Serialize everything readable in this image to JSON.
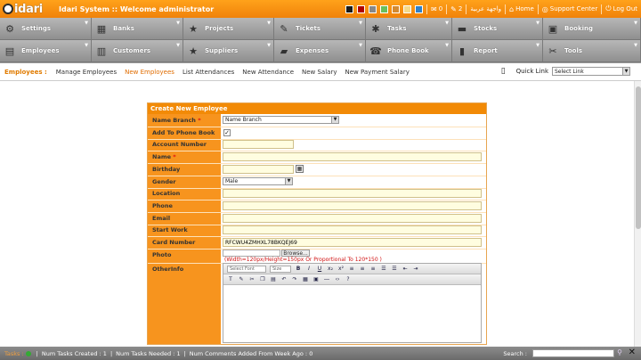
{
  "app": {
    "logo_text": "idari",
    "title": "Idari System :: Welcome administrator"
  },
  "topbar": {
    "swatches": [
      "#1a1a1a",
      "#b00000",
      "#888888",
      "#6bbf5b",
      "#d48a30",
      "#f5d98a",
      "#2f80c8"
    ],
    "mail_count": "0",
    "tasks_count": "2",
    "arabic_label": "واجهة عربية",
    "home_label": "Home",
    "support_label": "Support Center",
    "logout_label": "Log Out"
  },
  "modules": [
    {
      "label": "Settings",
      "icon": "wrench-icon",
      "glyph": "⚙"
    },
    {
      "label": "Banks",
      "icon": "bank-icon",
      "glyph": "▦"
    },
    {
      "label": "Projects",
      "icon": "star-icon",
      "glyph": "★"
    },
    {
      "label": "Tickets",
      "icon": "ticket-icon",
      "glyph": "✎"
    },
    {
      "label": "Tasks",
      "icon": "tasks-icon",
      "glyph": "✱"
    },
    {
      "label": "Stocks",
      "icon": "truck-icon",
      "glyph": "▬"
    },
    {
      "label": "Booking",
      "icon": "booking-icon",
      "glyph": "▣"
    },
    {
      "label": "Employees",
      "icon": "employees-icon",
      "glyph": "▤"
    },
    {
      "label": "Customers",
      "icon": "customers-icon",
      "glyph": "▥"
    },
    {
      "label": "Suppliers",
      "icon": "suppliers-icon",
      "glyph": "★"
    },
    {
      "label": "Expenses",
      "icon": "expenses-icon",
      "glyph": "▰"
    },
    {
      "label": "Phone Book",
      "icon": "phonebook-icon",
      "glyph": "☎"
    },
    {
      "label": "Report",
      "icon": "report-icon",
      "glyph": "▮"
    },
    {
      "label": "Tools",
      "icon": "tools-icon",
      "glyph": "✂"
    }
  ],
  "subnav": {
    "section": "Employees :",
    "links": [
      "Manage Employees",
      "New Employees",
      "List Attendances",
      "New Attendance",
      "New Salary",
      "New Payment Salary"
    ],
    "active_index": 1,
    "quick_link_label": "Quick Link",
    "quick_link_value": "Select Link"
  },
  "form": {
    "title": "Create New Employee",
    "branch_label": "Name Branch",
    "branch_value": "Name Branch",
    "phonebook_label": "Add To Phone Book",
    "phonebook_checked": "✓",
    "account_label": "Account Number",
    "name_label": "Name",
    "birthday_label": "Birthday",
    "gender_label": "Gender",
    "gender_value": "Male",
    "location_label": "Location",
    "phone_label": "Phone",
    "email_label": "Email",
    "startwork_label": "Start Work",
    "card_label": "Card Number",
    "card_value": "RFCWU4ZMHXL78BKQEJ69",
    "photo_label": "Photo",
    "browse_label": "Browse...",
    "photo_hint": "(Width=120px/Height=150px Or Proportional To 120*150 )",
    "otherinfo_label": "OtherInfo",
    "editor_font": "Select Font",
    "editor_size": "Size",
    "required_mark": "*"
  },
  "status": {
    "item1": "Tasks :",
    "item2": "Num Tasks Created :",
    "item2_val": "1",
    "item3": "Num Tasks Needed :",
    "item3_val": "1",
    "item4": "Num Comments Added From Week Ago :",
    "item4_val": "0",
    "search_label": "Search :"
  }
}
